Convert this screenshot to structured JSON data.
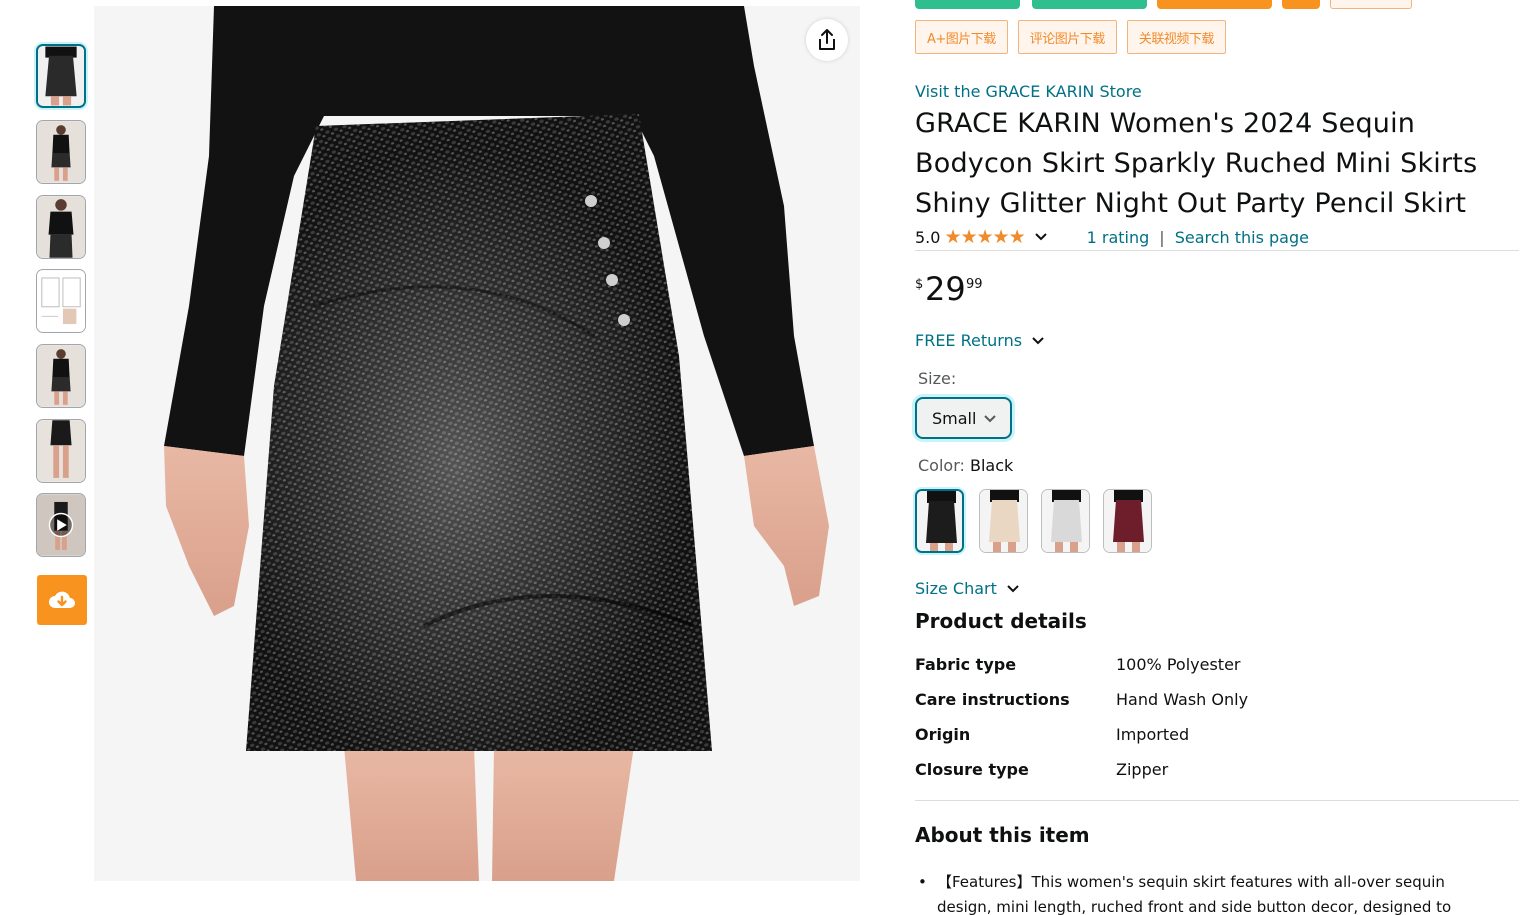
{
  "thumbnails": [
    {
      "name": "thumb-1",
      "selected": true,
      "kind": "skirt-front"
    },
    {
      "name": "thumb-2",
      "selected": false,
      "kind": "model-full"
    },
    {
      "name": "thumb-3",
      "selected": false,
      "kind": "model-top"
    },
    {
      "name": "thumb-4",
      "selected": false,
      "kind": "size-chart"
    },
    {
      "name": "thumb-5",
      "selected": false,
      "kind": "model-full"
    },
    {
      "name": "thumb-6",
      "selected": false,
      "kind": "model-legs"
    },
    {
      "name": "thumb-7",
      "selected": false,
      "kind": "video"
    }
  ],
  "download_buttons": {
    "aplus": "A+图片下载",
    "reviews": "评论图片下载",
    "video": "关联视频下载"
  },
  "store_link": "Visit the GRACE KARIN Store",
  "title": "GRACE KARIN Women's 2024 Sequin Bodycon Skirt Sparkly Ruched Mini Skirts Shiny Glitter Night Out Party Pencil Skirt",
  "rating": {
    "score": "5.0",
    "stars": "★★★★★",
    "count_text": "1 rating",
    "separator": "|",
    "search_text": "Search this page"
  },
  "price": {
    "symbol": "$",
    "whole": "29",
    "fraction": "99"
  },
  "free_returns": "FREE Returns",
  "size": {
    "label": "Size:",
    "selected": "Small"
  },
  "color": {
    "label": "Color:",
    "selected": "Black",
    "options": [
      "#1c1c1c",
      "#e9d6c3",
      "#d9d9d9",
      "#6e1d2a"
    ]
  },
  "size_chart": "Size Chart",
  "product_details": {
    "title": "Product details",
    "rows": [
      {
        "k": "Fabric type",
        "v": "100% Polyester"
      },
      {
        "k": "Care instructions",
        "v": "Hand Wash Only"
      },
      {
        "k": "Origin",
        "v": "Imported"
      },
      {
        "k": "Closure type",
        "v": "Zipper"
      }
    ]
  },
  "about": {
    "title": "About this item",
    "bullets": [
      "【Features】This women's sequin skirt features with all-over sequin design, mini length, ruched front and side button decor, designed to"
    ]
  },
  "colors": {
    "link": "#007185",
    "accent_orange": "#f08b2d",
    "select_border": "#007185"
  }
}
